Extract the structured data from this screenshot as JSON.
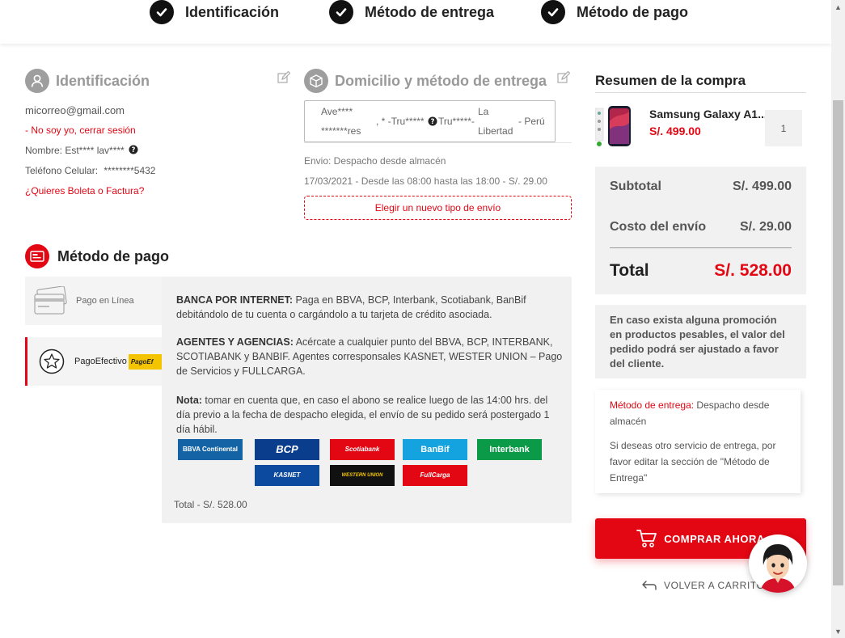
{
  "stepper": {
    "steps": [
      {
        "label": "Identificación"
      },
      {
        "label": "Método de entrega"
      },
      {
        "label": "Método de pago"
      }
    ]
  },
  "identification": {
    "title": "Identificación",
    "email": "micorreo@gmail.com",
    "logout": "- No soy yo, cerrar sesión",
    "name": "Nombre: Est**** lav****",
    "phone_label": "Teléfono Celular:",
    "phone_value": "********5432",
    "invoice_link": "¿Quieres Boleta o Factura?"
  },
  "delivery": {
    "title": "Domicilio y método de entrega",
    "address": {
      "part1": "Ave****",
      "part2": "*******res",
      "part3": ", * -Tru*****",
      "part4": "Tru*****-",
      "part5": "La",
      "part6": "Libertad",
      "part7": "- Perú"
    },
    "shipping": "Envio: Despacho desde almacén",
    "schedule": "17/03/2021 - Desde las 08:00 hasta las 18:00 - S/. 29.00",
    "change_button": "Elegir un nuevo tipo de envío"
  },
  "payment": {
    "title": "Método de pago",
    "options": [
      {
        "label": "Pago en Línea"
      },
      {
        "label": "PagoEfectivo",
        "badge": "PagoEf"
      }
    ],
    "detail": {
      "p1_bold": "BANCA POR INTERNET:",
      "p1": " Paga en BBVA, BCP, Interbank, Scotiabank, BanBif debitándolo de tu cuenta o cargándolo a tu tarjeta de crédito asociada.",
      "p2_bold": "AGENTES Y AGENCIAS:",
      "p2": " Acércate a cualquier punto del BBVA, BCP, INTERBANK, SCOTIABANK y BANBIF. Agentes corresponsales KASNET, WESTER UNION – Pago de Servicios y FULLCARGA.",
      "p3_bold": "Nota:",
      "p3": " tomar en cuenta que, en caso el abono se realice luego de las 14:00 hrs. del día previo a la fecha de despacho elegida, el envío de su pedido será postergado 1 día hábil.",
      "banks": [
        "BBVA Continental",
        "BCP",
        "Scotiabank",
        "BanBif",
        "Interbank",
        "KASNET",
        "WESTERN UNION",
        "FullCarga"
      ],
      "total": "Total - S/. 528.00"
    }
  },
  "summary": {
    "title": "Resumen de la compra",
    "product_name": "Samsung Galaxy A1...",
    "product_price": "S/. 499.00",
    "quantity": "1",
    "subtotal_label": "Subtotal",
    "subtotal_value": "S/. 499.00",
    "shipping_label": "Costo del envío",
    "shipping_value": "S/. 29.00",
    "total_label": "Total",
    "total_value": "S/. 528.00",
    "promo_note": "En caso exista alguna promoción en productos pesables, el valor del pedido podrá ser ajustado a favor del cliente.",
    "delivery_label": "Método de entrega:",
    "delivery_value": " Despacho desde almacén",
    "delivery_help": "Si deseas otro servicio de entrega, por favor editar la sección de \"Método de Entrega\"",
    "buy_button": "COMPRAR AHORA",
    "back_link": "VOLVER A CARRITO"
  },
  "colors": {
    "accent": "#e30613",
    "panel": "#f1f1f1"
  }
}
